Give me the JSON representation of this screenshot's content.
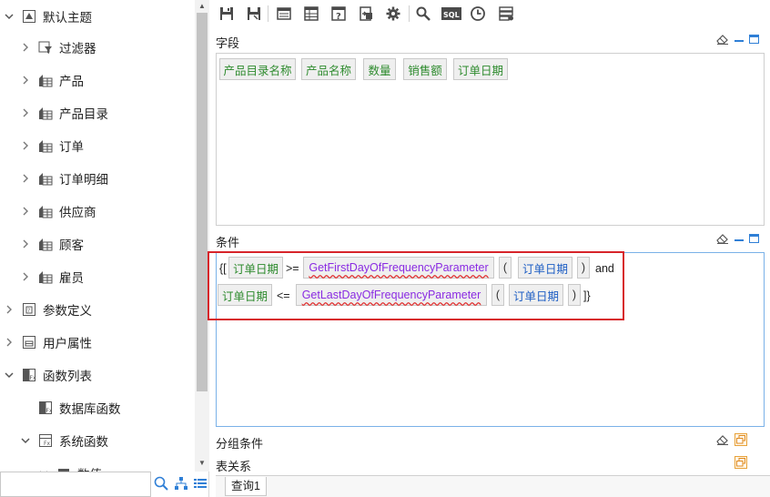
{
  "tree": {
    "items": [
      {
        "label": "默认主题",
        "expanded": true,
        "icon": "theme-icon"
      },
      {
        "label": "过滤器",
        "expanded": false,
        "icon": "filter-icon"
      },
      {
        "label": "产品",
        "expanded": false,
        "icon": "table-icon"
      },
      {
        "label": "产品目录",
        "expanded": false,
        "icon": "table-icon"
      },
      {
        "label": "订单",
        "expanded": false,
        "icon": "table-icon"
      },
      {
        "label": "订单明细",
        "expanded": false,
        "icon": "table-icon"
      },
      {
        "label": "供应商",
        "expanded": false,
        "icon": "table-icon"
      },
      {
        "label": "顾客",
        "expanded": false,
        "icon": "table-icon"
      },
      {
        "label": "雇员",
        "expanded": false,
        "icon": "table-icon"
      },
      {
        "label": "参数定义",
        "expanded": false,
        "icon": "param-icon"
      },
      {
        "label": "用户属性",
        "expanded": false,
        "icon": "user-attr-icon"
      },
      {
        "label": "函数列表",
        "expanded": true,
        "icon": "function-list-icon"
      },
      {
        "label": "数据库函数",
        "expanded": false,
        "icon": "function-icon"
      },
      {
        "label": "系统函数",
        "expanded": true,
        "icon": "function-icon"
      },
      {
        "label": "数值",
        "expanded": false,
        "icon": "folder-icon"
      }
    ],
    "search": {
      "value": "",
      "placeholder": ""
    }
  },
  "toolbar": {
    "buttons": [
      "save-icon",
      "save-as-icon",
      "layout-icon",
      "table-layout-icon",
      "help-icon",
      "export-icon",
      "settings-icon",
      "search-icon",
      "sql-icon",
      "clock-icon",
      "list-settings-icon"
    ],
    "sql_label": "SQL"
  },
  "fields_section": {
    "title": "字段",
    "chips": [
      "产品目录名称",
      "产品名称",
      "数量",
      "销售额",
      "订单日期"
    ]
  },
  "condition_section": {
    "title": "条件",
    "line1": {
      "open": "{[",
      "field1": "订单日期",
      "op": ">=",
      "func": "GetFirstDayOfFrequencyParameter",
      "lparen": "(",
      "field2": "订单日期",
      "rparen": ")",
      "and": "and"
    },
    "line2": {
      "field1": "订单日期",
      "op": "<=",
      "func": "GetLastDayOfFrequencyParameter",
      "lparen": "(",
      "field2": "订单日期",
      "rparen": ")",
      "close": "]}"
    }
  },
  "group_section": {
    "title": "分组条件"
  },
  "relation_section": {
    "title": "表关系"
  },
  "tabs": {
    "query1": "查询1"
  },
  "colors": {
    "accent_blue": "#2f7fd6",
    "field_green": "#2e8b2e",
    "highlight_red": "#d7242a"
  }
}
